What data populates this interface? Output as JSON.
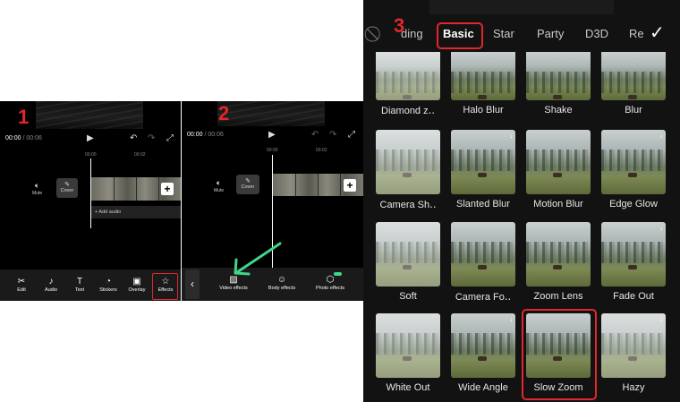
{
  "steps": {
    "one": "1",
    "two": "2",
    "three": "3"
  },
  "panel1": {
    "time_current": "00:00",
    "time_total": " / 00:06",
    "ruler": [
      "00:00",
      "00:02"
    ],
    "mute_label": "Mute",
    "cover_label": "Cover",
    "add_audio": "+ Add audio",
    "tools": [
      {
        "icon": "scissors-icon",
        "glyph": "✂",
        "label": "Edit"
      },
      {
        "icon": "music-note-icon",
        "glyph": "♪",
        "label": "Audio"
      },
      {
        "icon": "text-icon",
        "glyph": "T",
        "label": "Text"
      },
      {
        "icon": "sticker-icon",
        "glyph": "◔",
        "label": "Stickers"
      },
      {
        "icon": "overlay-icon",
        "glyph": "▣",
        "label": "Overlay"
      },
      {
        "icon": "effects-icon",
        "glyph": "☆",
        "label": "Effects"
      }
    ]
  },
  "panel2": {
    "time_current": "00:00",
    "time_total": " / 00:06",
    "ruler": [
      "00:00",
      "00:02"
    ],
    "mute_label": "Mute",
    "cover_label": "Cover",
    "tools": [
      {
        "icon": "video-effects-icon",
        "glyph": "▨",
        "label": "Video effects"
      },
      {
        "icon": "body-effects-icon",
        "glyph": "☺",
        "label": "Body effects"
      },
      {
        "icon": "photo-effects-icon",
        "glyph": "⬡",
        "label": "Photo effects"
      }
    ],
    "arrow_color": "#3fd68a"
  },
  "panel3": {
    "tabs": [
      "ding",
      "Basic",
      "Star",
      "Party",
      "D3D",
      "Re"
    ],
    "active_tab": "Basic",
    "effects": [
      "Diamond z․․",
      "Halo Blur",
      "Shake",
      "Blur",
      "Camera Sh․․",
      "Slanted Blur",
      "Motion Blur",
      "Edge Glow",
      "Soft",
      "Camera Fo․․",
      "Zoom Lens",
      "Fade Out",
      "White Out",
      "Wide Angle",
      "Slow Zoom",
      "Hazy"
    ],
    "selected_effect": "Slow Zoom"
  },
  "colors": {
    "highlight_red": "#e0282c",
    "arrow_green": "#3fd68a"
  }
}
